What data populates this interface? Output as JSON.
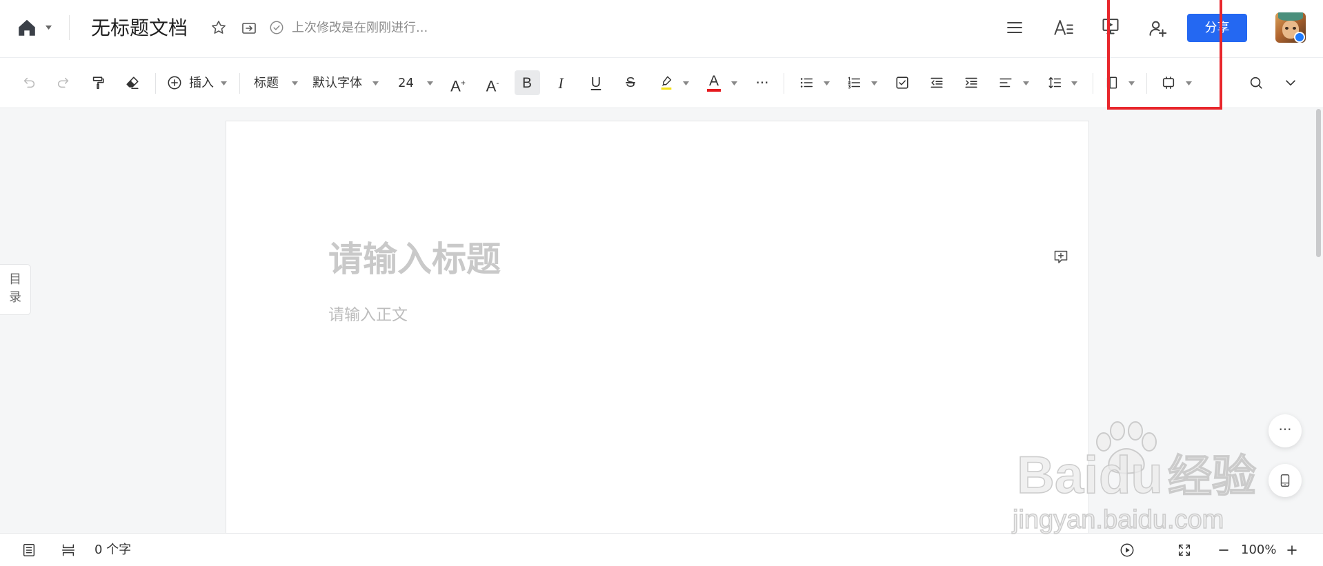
{
  "header": {
    "title": "无标题文档",
    "save_status": "上次修改是在刚刚进行...",
    "share_label": "分享"
  },
  "toolbar": {
    "insert_label": "插入",
    "paragraph_style": "标题",
    "font_family": "默认字体",
    "font_size": "24",
    "font_grow": {
      "letter": "A",
      "sign": "+"
    },
    "font_shrink": {
      "letter": "A",
      "sign": "-"
    },
    "bold": "B",
    "italic": "I",
    "underline": "U",
    "strikethrough": "S",
    "font_color": "A",
    "more": "···"
  },
  "editor": {
    "title_placeholder": "请输入标题",
    "body_placeholder": "请输入正文"
  },
  "toc_tab": {
    "line1": "目",
    "line2": "录"
  },
  "float_actions": {
    "more": "···"
  },
  "status_bar": {
    "word_count": "0 个字",
    "zoom": "100%"
  },
  "watermark": {
    "brand_left": "Bai",
    "brand_right": "du",
    "brand_cn": "经验",
    "url": "jingyan.baidu.com"
  },
  "colors": {
    "accent": "#2468f2",
    "highlight": "#f5e21b",
    "font_color": "#e5191e",
    "annotation": "#e8262c",
    "placeholder": "#c9c9c9"
  },
  "icons": {
    "header_left": [
      "home-icon",
      "star-icon",
      "move-to-folder-icon",
      "saved-check-icon"
    ],
    "header_right": [
      "outline-list-icon",
      "text-style-icon",
      "present-icon",
      "add-collaborator-icon"
    ],
    "toolbar": [
      "undo-icon",
      "redo-icon",
      "format-painter-icon",
      "eraser-icon",
      "plus-circle-icon",
      "highlighter-icon",
      "bullet-list-icon",
      "numbered-list-icon",
      "checklist-icon",
      "outdent-icon",
      "indent-icon",
      "align-left-icon",
      "line-spacing-icon",
      "page-layout-icon",
      "device-icon",
      "search-icon",
      "chevron-down-icon"
    ],
    "status_bar": [
      "doc-outline-icon",
      "page-break-icon",
      "play-icon",
      "fullscreen-icon",
      "zoom-out-icon",
      "zoom-in-icon"
    ]
  }
}
